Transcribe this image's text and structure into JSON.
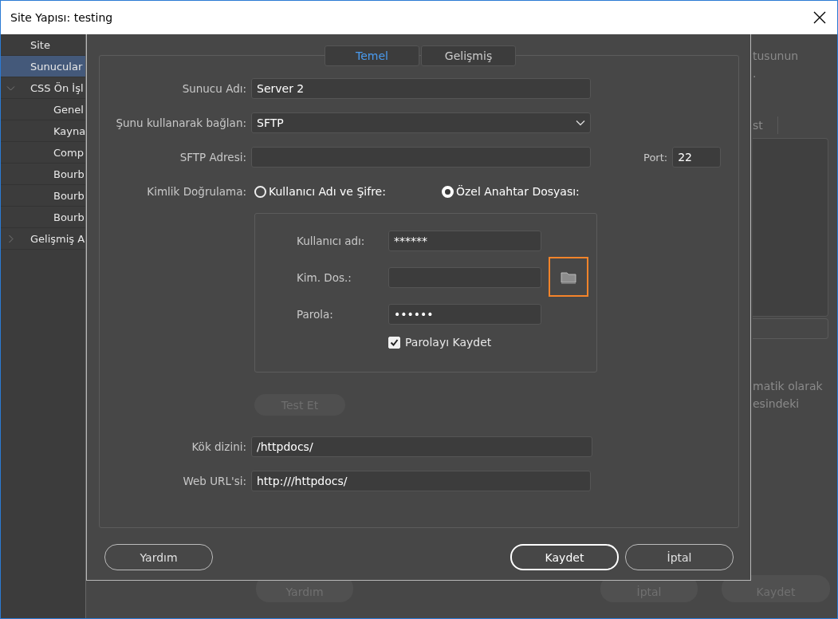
{
  "window": {
    "title": "Site Yapısı: testing"
  },
  "sidebar": {
    "items": [
      {
        "label": "Site",
        "selected": false
      },
      {
        "label": "Sunucular",
        "selected": true
      },
      {
        "label": "CSS Ön İşl",
        "selected": false,
        "expanded": true,
        "children": [
          {
            "label": "Genel",
            "selected": false
          },
          {
            "label": "Kayna",
            "selected": false
          },
          {
            "label": "Comp",
            "selected": false
          },
          {
            "label": "Bourb",
            "selected": false
          },
          {
            "label": "Bourb",
            "selected": false
          },
          {
            "label": "Bourb",
            "selected": false
          }
        ]
      },
      {
        "label": "Gelişmiş A",
        "selected": false,
        "expanded": false
      }
    ]
  },
  "background": {
    "texts_top": [
      "tusunun",
      "."
    ],
    "tab_label": "st",
    "texts_bottom": [
      "matik olarak",
      "esindeki"
    ],
    "buttons": [
      "Yardım",
      "İptal",
      "Kaydet"
    ]
  },
  "dialog": {
    "tabs": [
      {
        "label": "Temel",
        "selected": true
      },
      {
        "label": "Gelişmiş",
        "selected": false
      }
    ],
    "server_name": {
      "label": "Sunucu Adı:",
      "value": "Server 2"
    },
    "connect_using": {
      "label": "Şunu kullanarak bağlan:",
      "value": "SFTP"
    },
    "sftp_address": {
      "label": "SFTP Adresi:"
    },
    "port": {
      "label": "Port:",
      "value": "22"
    },
    "authentication": {
      "label": "Kimlik Doğrulama:",
      "options": [
        {
          "label": "Kullanıcı Adı ve Şifre:",
          "selected": false
        },
        {
          "label": "Özel Anahtar Dosyası:",
          "selected": true
        }
      ]
    },
    "username": {
      "label": "Kullanıcı adı:",
      "value": "******"
    },
    "identity_file": {
      "label": "Kim. Dos.:"
    },
    "password": {
      "label": "Parola:",
      "value": "••••••"
    },
    "save_password": {
      "label": "Parolayı Kaydet",
      "checked": true
    },
    "test_button": {
      "label": "Test Et",
      "disabled": true
    },
    "root_directory": {
      "label": "Kök dizini:",
      "value": "/httpdocs/"
    },
    "web_url": {
      "label": "Web URL'si:",
      "value": "http:///httpdocs/"
    },
    "buttons": [
      {
        "label": "Yardım",
        "kind": "normal"
      },
      {
        "label": "Kaydet",
        "kind": "default"
      },
      {
        "label": "İptal",
        "kind": "normal"
      }
    ]
  }
}
